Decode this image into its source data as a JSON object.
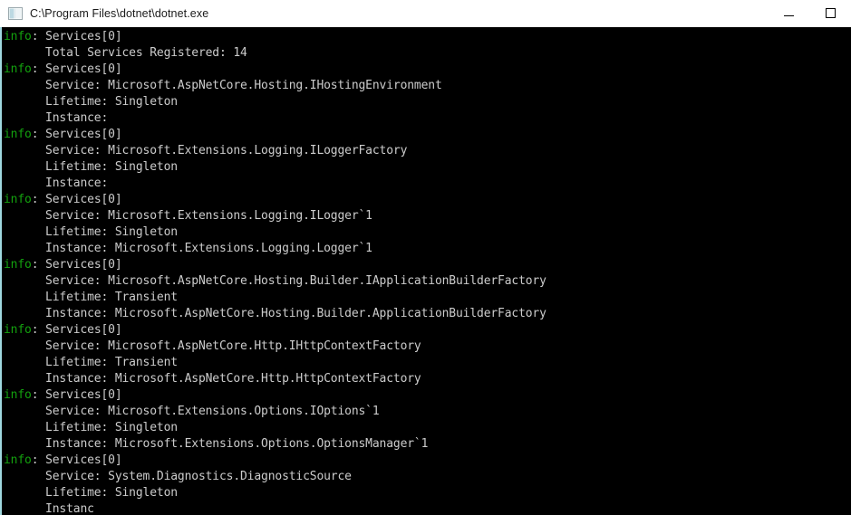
{
  "window": {
    "title": "C:\\Program Files\\dotnet\\dotnet.exe",
    "icon": "console-window-icon",
    "titlebar_bg": "#ffffff",
    "console_bg": "#000000",
    "text_color": "#cccccc",
    "accent_border": "#9fd9e0",
    "controls": {
      "minimize_label": "Minimize",
      "maximize_label": "Maximize",
      "minimize_icon": "minimize-icon",
      "maximize_icon": "maximize-icon"
    }
  },
  "console": {
    "severity_label": "info",
    "severity_color": "#13a10e",
    "category": "Services[0]",
    "lines": [
      {
        "severity": "info",
        "text": "Services[0]"
      },
      {
        "severity": "",
        "text": "      Total Services Registered: 14"
      },
      {
        "severity": "info",
        "text": "Services[0]"
      },
      {
        "severity": "",
        "text": "      Service: Microsoft.AspNetCore.Hosting.IHostingEnvironment"
      },
      {
        "severity": "",
        "text": "      Lifetime: Singleton"
      },
      {
        "severity": "",
        "text": "      Instance:"
      },
      {
        "severity": "info",
        "text": "Services[0]"
      },
      {
        "severity": "",
        "text": "      Service: Microsoft.Extensions.Logging.ILoggerFactory"
      },
      {
        "severity": "",
        "text": "      Lifetime: Singleton"
      },
      {
        "severity": "",
        "text": "      Instance:"
      },
      {
        "severity": "info",
        "text": "Services[0]"
      },
      {
        "severity": "",
        "text": "      Service: Microsoft.Extensions.Logging.ILogger`1"
      },
      {
        "severity": "",
        "text": "      Lifetime: Singleton"
      },
      {
        "severity": "",
        "text": "      Instance: Microsoft.Extensions.Logging.Logger`1"
      },
      {
        "severity": "info",
        "text": "Services[0]"
      },
      {
        "severity": "",
        "text": "      Service: Microsoft.AspNetCore.Hosting.Builder.IApplicationBuilderFactory"
      },
      {
        "severity": "",
        "text": "      Lifetime: Transient"
      },
      {
        "severity": "",
        "text": "      Instance: Microsoft.AspNetCore.Hosting.Builder.ApplicationBuilderFactory"
      },
      {
        "severity": "info",
        "text": "Services[0]"
      },
      {
        "severity": "",
        "text": "      Service: Microsoft.AspNetCore.Http.IHttpContextFactory"
      },
      {
        "severity": "",
        "text": "      Lifetime: Transient"
      },
      {
        "severity": "",
        "text": "      Instance: Microsoft.AspNetCore.Http.HttpContextFactory"
      },
      {
        "severity": "info",
        "text": "Services[0]"
      },
      {
        "severity": "",
        "text": "      Service: Microsoft.Extensions.Options.IOptions`1"
      },
      {
        "severity": "",
        "text": "      Lifetime: Singleton"
      },
      {
        "severity": "",
        "text": "      Instance: Microsoft.Extensions.Options.OptionsManager`1"
      },
      {
        "severity": "info",
        "text": "Services[0]"
      },
      {
        "severity": "",
        "text": "      Service: System.Diagnostics.DiagnosticSource"
      },
      {
        "severity": "",
        "text": "      Lifetime: Singleton"
      },
      {
        "severity": "",
        "text": "      Instanc"
      }
    ]
  }
}
